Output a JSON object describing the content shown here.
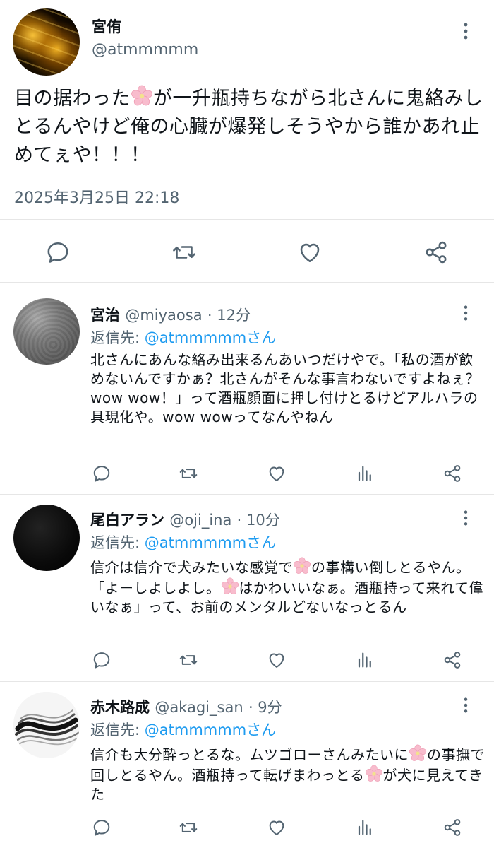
{
  "main_tweet": {
    "display_name": "宮侑",
    "handle": "@atmmmmm",
    "text_parts": [
      "目の据わった",
      "が一升瓶持ちながら北さんに鬼絡みしとるんやけど俺の心臓が爆発しそうやから誰かあれ止めてぇや！！！"
    ],
    "timestamp": "2025年3月25日 22:18",
    "actions": [
      "reply-icon",
      "retweet-icon",
      "like-icon",
      "share-icon"
    ]
  },
  "replies": [
    {
      "display_name": "宮治",
      "handle": "@miyaosa",
      "time": "· 12分",
      "replying_label": "返信先: ",
      "replying_handle": "@atmmmmmさん",
      "body": "北さんにあんな絡み出来るんあいつだけやで。「私の酒が飲めないんですかぁ？北さんがそんな事言わないですよねぇ？wow wow！」って酒瓶顔面に押し付けとるけどアルハラの具現化や。wow wowってなんやねん",
      "actions": [
        "reply-icon",
        "retweet-icon",
        "like-icon",
        "stats-icon",
        "share-icon"
      ]
    },
    {
      "display_name": "尾白アラン",
      "handle": "@oji_ina",
      "time": "· 10分",
      "replying_label": "返信先: ",
      "replying_handle": "@atmmmmmさん",
      "body_parts": [
        "信介は信介で犬みたいな感覚で",
        "の事構い倒しとるやん。「よーしよしよし。",
        "はかわいいなぁ。酒瓶持って来れて偉いなぁ」って、お前のメンタルどないなっとるん"
      ],
      "actions": [
        "reply-icon",
        "retweet-icon",
        "like-icon",
        "stats-icon",
        "share-icon"
      ]
    },
    {
      "display_name": "赤木路成",
      "handle": "@akagi_san",
      "time": "· 9分",
      "replying_label": "返信先: ",
      "replying_handle": "@atmmmmmさん",
      "body_parts": [
        "信介も大分酔っとるな。ムツゴローさんみたいに",
        "の事撫で回しとるやん。酒瓶持って転げまわっとる",
        "が犬に見えてきた"
      ],
      "actions": [
        "reply-icon",
        "retweet-icon",
        "like-icon",
        "stats-icon",
        "share-icon"
      ]
    }
  ],
  "colors": {
    "text": "#0f1419",
    "secondary": "#536471",
    "link": "#1d9bf0",
    "divider": "#e6e6e6",
    "sakura": "#f6b7c9"
  }
}
